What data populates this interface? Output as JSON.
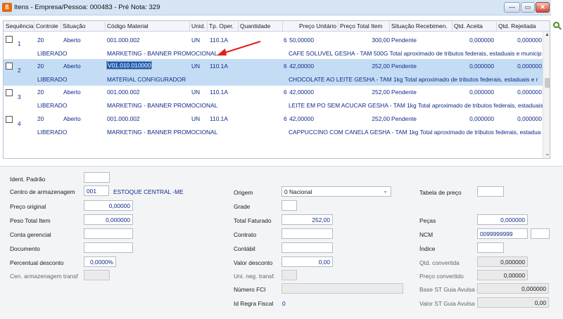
{
  "window": {
    "title": "Itens - Empresa/Pessoa: 000483 - Pré Nota: 329",
    "app_icon_glyph": "ß",
    "minimize_glyph": "—",
    "maximize_glyph": "▭",
    "close_glyph": "✕"
  },
  "grid": {
    "headers": [
      "Sequência",
      "Controle",
      "Situação",
      "Código Material",
      "Unid.",
      "Tp. Oper.",
      "Quantidade",
      "Preço Unitário",
      "Preço Total Item",
      "Situação Recebimen.",
      "Qtd. Aceita",
      "Qtd. Rejeitada"
    ],
    "rows": [
      {
        "seq": "1",
        "controle": "20",
        "situacao": "Aberto",
        "codigo": "001.000.002",
        "unid": "UN",
        "tp_oper": "110.1A",
        "quantidade": "6",
        "preco_unit": "50,00000",
        "preco_total": "300,00",
        "sit_receb": "Pendente",
        "qtd_aceita": "0,000000",
        "qtd_rejeitada": "0,000000",
        "status": "LIBERADO",
        "descricao_material": "MARKETING - BANNER PROMOCIONAL",
        "descricao_produto": "CAFE SOLUVEL GESHA - TAM 500G Total aproximado de tributos federais, estaduais e municip"
      },
      {
        "seq": "2",
        "controle": "20",
        "situacao": "Aberto",
        "codigo": "V01.010.010000",
        "unid": "UN",
        "tp_oper": "110.1A",
        "quantidade": "6",
        "preco_unit": "42,00000",
        "preco_total": "252,00",
        "sit_receb": "Pendente",
        "qtd_aceita": "0,000000",
        "qtd_rejeitada": "0,000000",
        "status": "LIBERADO",
        "descricao_material": "MATERIAL CONFIGURADOR",
        "descricao_produto": "CHOCOLATE AO LEITE GESHA - TAM 1kg Total aproximado de tributos federais, estaduais e r"
      },
      {
        "seq": "3",
        "controle": "20",
        "situacao": "Aberto",
        "codigo": "001.000.002",
        "unid": "UN",
        "tp_oper": "110.1A",
        "quantidade": "6",
        "preco_unit": "42,00000",
        "preco_total": "252,00",
        "sit_receb": "Pendente",
        "qtd_aceita": "0,000000",
        "qtd_rejeitada": "0,000000",
        "status": "LIBERADO",
        "descricao_material": "MARKETING - BANNER PROMOCIONAL",
        "descricao_produto": "LEITE EM PO SEM ACUCAR GESHA - TAM 1kg Total aproximado de tributos federais, estaduais"
      },
      {
        "seq": "4",
        "controle": "20",
        "situacao": "Aberto",
        "codigo": "001.000.002",
        "unid": "UN",
        "tp_oper": "110.1A",
        "quantidade": "6",
        "preco_unit": "42,00000",
        "preco_total": "252,00",
        "sit_receb": "Pendente",
        "qtd_aceita": "0,000000",
        "qtd_rejeitada": "0,000000",
        "status": "LIBERADO",
        "descricao_material": "MARKETING - BANNER PROMOCIONAL",
        "descricao_produto": "CAPPUCCINO COM CANELA GESHA - TAM 1kg Total aproximado de tributos federais, estadua"
      }
    ],
    "scroll_up_glyph": "▲",
    "scroll_down_glyph": "⌄"
  },
  "form": {
    "ident_padrao": {
      "label": "Ident. Padrão",
      "value": ""
    },
    "centro_armazenagem": {
      "label": "Centro de armazenagem",
      "code": "001",
      "name": "ESTOQUE CENTRAL -ME"
    },
    "preco_original": {
      "label": "Preço original",
      "value": "0,00000"
    },
    "peso_total_item": {
      "label": "Peso Total Item",
      "value": "0,000000"
    },
    "conta_gerencial": {
      "label": "Conta gerencial",
      "value": ""
    },
    "documento": {
      "label": "Documento",
      "value": ""
    },
    "percentual_desconto": {
      "label": "Percentual desconto",
      "value": "0,0000%"
    },
    "cen_armazenagem_transf": {
      "label": "Cen. armazenagem transf",
      "value": ""
    },
    "origem": {
      "label": "Origem",
      "value": "0 Nacional"
    },
    "grade": {
      "label": "Grade",
      "value": ""
    },
    "total_faturado": {
      "label": "Total Faturado",
      "value": "252,00"
    },
    "contrato": {
      "label": "Contrato",
      "value": ""
    },
    "contabil": {
      "label": "Contábil",
      "value": ""
    },
    "valor_desconto": {
      "label": "Valor desconto",
      "value": "0,00"
    },
    "uni_neg_transf": {
      "label": "Uni. neg. transf.",
      "value": ""
    },
    "numero_fci": {
      "label": "Número FCI",
      "value": ""
    },
    "id_regra_fiscal": {
      "label": "Id Regra Fiscal",
      "value": "0"
    },
    "tabela_preco": {
      "label": "Tabela de preço",
      "value": ""
    },
    "pecas": {
      "label": "Peças",
      "value": "0,000000"
    },
    "ncm": {
      "label": "NCM",
      "value": "0099999999",
      "extra": ""
    },
    "indice": {
      "label": "Índice",
      "value": ""
    },
    "qtd_convertida": {
      "label": "Qtd. convertida",
      "value": "0,000000"
    },
    "preco_convertido": {
      "label": "Preço convertido",
      "value": "0,00000"
    },
    "base_st_guia_avulsa": {
      "label": "Base ST Guia Avulsa",
      "value": "0,000000"
    },
    "valor_st_guia_avulsa": {
      "label": "Valor ST Guia Avulsa",
      "value": "0,00"
    }
  },
  "colors": {
    "selected_row": "#c5ddf4",
    "link_text": "#0d2a8a",
    "annotation_arrow": "#e0201b"
  },
  "icons": [
    "app-icon",
    "minimize-icon",
    "maximize-icon",
    "close-icon",
    "search-icon",
    "checkbox-icon",
    "annotation-arrow-icon",
    "dropdown-chevron-icon"
  ]
}
